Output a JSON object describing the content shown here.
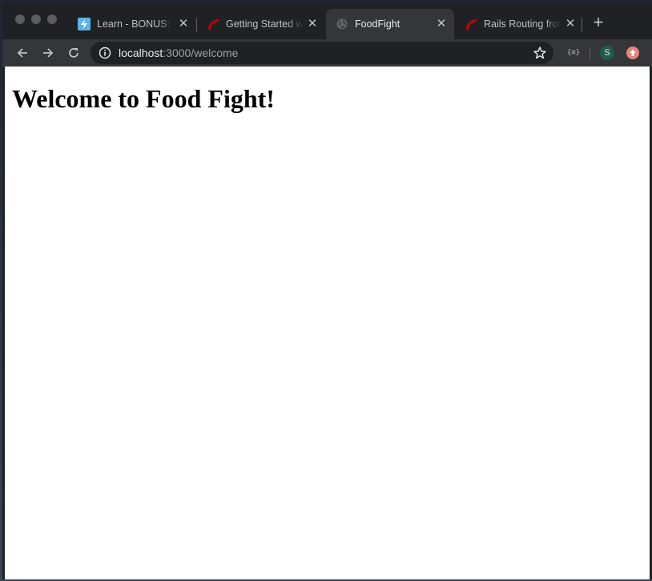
{
  "tabs": [
    {
      "title": "Learn - BONUS: Building a Rails app",
      "icon": "learn-lightning-icon"
    },
    {
      "title": "Getting Started with Rails",
      "icon": "rails-icon"
    },
    {
      "title": "FoodFight",
      "icon": "globe-icon",
      "active": true
    },
    {
      "title": "Rails Routing from the Outside In",
      "icon": "rails-icon"
    }
  ],
  "address_bar": {
    "host": "localhost",
    "path": ":3000/welcome"
  },
  "profile": {
    "initial": "S"
  },
  "extension": {
    "json_label": "{≡}"
  },
  "page": {
    "heading": "Welcome to Food Fight!"
  },
  "colors": {
    "tab_strip": "#202124",
    "toolbar": "#35363a",
    "learn_icon": "#5ab4e6",
    "rails_icon": "#cc0000",
    "avatar": "#1d5c47",
    "update_badge": "#e8837a"
  }
}
